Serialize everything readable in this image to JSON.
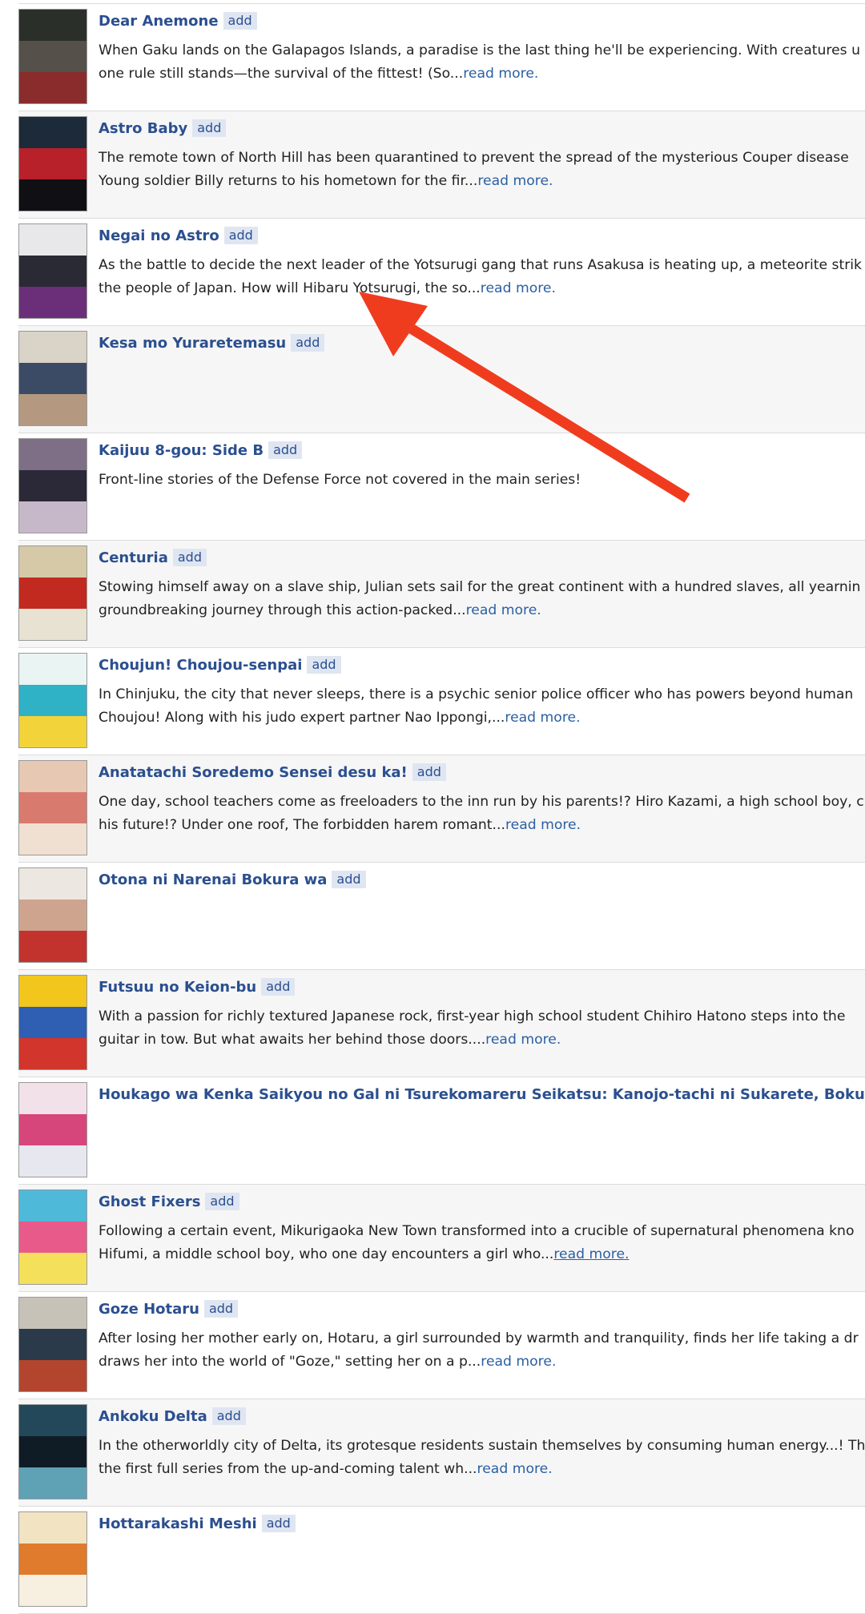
{
  "items": [
    {
      "title": "Dear Anemone",
      "add": "add",
      "desc": [
        "When Gaku lands on the Galapagos Islands, a paradise is the last thing he'll be experiencing. With creatures u",
        "one rule still stands—the survival of the fittest! (So..."
      ],
      "more": "read more.",
      "colors": [
        "#2b2f2a",
        "#55504a",
        "#8a2c2c"
      ]
    },
    {
      "title": "Astro Baby",
      "add": "add",
      "desc": [
        "The remote town of North Hill has been quarantined to prevent the spread of the mysterious Couper disease",
        "Young soldier Billy returns to his hometown for the fir..."
      ],
      "more": "read more.",
      "colors": [
        "#1d2a3a",
        "#b8202a",
        "#0f0f14"
      ]
    },
    {
      "title": "Negai no Astro",
      "add": "add",
      "desc": [
        "As the battle to decide the next leader of the Yotsurugi gang that runs Asakusa is heating up, a meteorite strik",
        "the people of Japan. How will Hibaru Yotsurugi, the so..."
      ],
      "more": "read more.",
      "colors": [
        "#e8e8ea",
        "#2a2a35",
        "#6b2f7a"
      ]
    },
    {
      "title": "Kesa mo Yuraretemasu",
      "add": "add",
      "desc": [],
      "more": "",
      "colors": [
        "#d9d3c8",
        "#3b4b66",
        "#b49880"
      ]
    },
    {
      "title": "Kaijuu 8-gou: Side B",
      "add": "add",
      "desc": [
        "Front-line stories of the Defense Force not covered in the main series!"
      ],
      "more": "",
      "colors": [
        "#7e6f87",
        "#2b2838",
        "#c7b8c9"
      ]
    },
    {
      "title": "Centuria",
      "add": "add",
      "desc": [
        "Stowing himself away on a slave ship, Julian sets sail for the great continent with a hundred slaves, all yearnin",
        "groundbreaking journey through this action-packed..."
      ],
      "more": "read more.",
      "colors": [
        "#d6c9a8",
        "#c22a1f",
        "#e8e2d2"
      ]
    },
    {
      "title": "Choujun! Choujou-senpai",
      "add": "add",
      "desc": [
        "In Chinjuku, the city that never sleeps, there is a psychic senior police officer who has powers beyond human",
        "Choujou! Along with his judo expert partner Nao Ippongi,..."
      ],
      "more": "read more.",
      "colors": [
        "#e9f4f3",
        "#2fb1c6",
        "#f2d43a"
      ]
    },
    {
      "title": "Anatatachi Soredemo Sensei desu ka!",
      "add": "add",
      "desc": [
        "One day, school teachers come as freeloaders to the inn run by his parents!? Hiro Kazami, a high school boy, c",
        "his future!? Under one roof, The forbidden harem romant..."
      ],
      "more": "read more.",
      "colors": [
        "#e6c8b3",
        "#d97a6f",
        "#f0e0d2"
      ]
    },
    {
      "title": "Otona ni Narenai Bokura wa",
      "add": "add",
      "desc": [],
      "more": "",
      "colors": [
        "#ede7e2",
        "#cfa48e",
        "#c2332e"
      ]
    },
    {
      "title": "Futsuu no Keion-bu",
      "add": "add",
      "desc": [
        "With a passion for richly textured Japanese rock, first-year high school student Chihiro Hatono steps into the",
        "guitar in tow. But what awaits her behind those doors...."
      ],
      "more": "read more.",
      "colors": [
        "#f2c61c",
        "#2e5fb3",
        "#d2352b"
      ]
    },
    {
      "title": "Houkago wa Kenka Saikyou no Gal ni Tsurekomareru Seikatsu: Kanojo-tachi ni Sukarete, Boku mo Saikyou",
      "add": "",
      "desc": [],
      "more": "",
      "colors": [
        "#f3e1ea",
        "#d6467a",
        "#e7e7ef"
      ]
    },
    {
      "title": "Ghost Fixers",
      "add": "add",
      "desc": [
        "Following a certain event, Mikurigaoka New Town transformed into a crucible of supernatural phenomena kno",
        "Hifumi, a middle school boy, who one day encounters a girl who..."
      ],
      "more": "read more.",
      "underline": true,
      "colors": [
        "#4fb9d9",
        "#e85a8a",
        "#f4e05a"
      ]
    },
    {
      "title": "Goze Hotaru",
      "add": "add",
      "desc": [
        "After losing her mother early on, Hotaru, a girl surrounded by warmth and tranquility, finds her life taking a dr",
        "draws her into the world of \"Goze,\" setting her on a p..."
      ],
      "more": "read more.",
      "colors": [
        "#c7c2b8",
        "#2b3a4a",
        "#b3452e"
      ]
    },
    {
      "title": "Ankoku Delta",
      "add": "add",
      "desc": [
        "In the otherworldly city of Delta, its grotesque residents sustain themselves by consuming human energy...! Th",
        "the first full series from the up-and-coming talent wh..."
      ],
      "more": "read more.",
      "colors": [
        "#23485a",
        "#0f1c26",
        "#5fa1b5"
      ]
    },
    {
      "title": "Hottarakashi Meshi",
      "add": "add",
      "desc": [],
      "more": "",
      "colors": [
        "#f2e4c3",
        "#e07a2c",
        "#f7efe0"
      ]
    }
  ]
}
